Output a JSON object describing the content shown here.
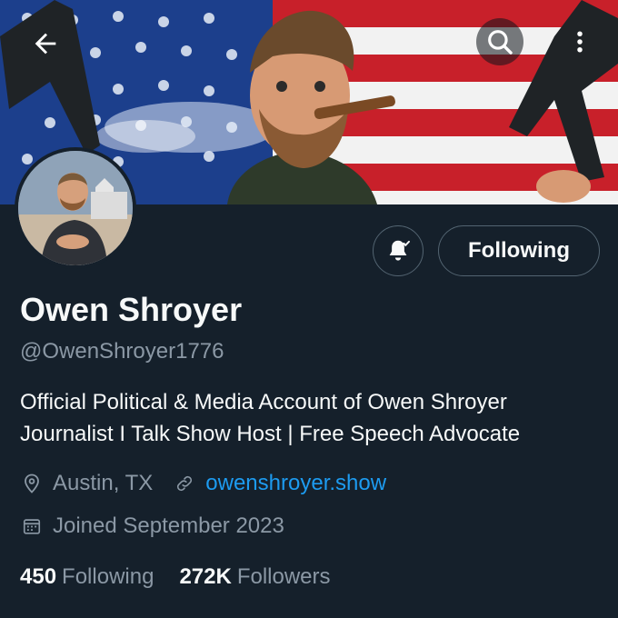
{
  "profile": {
    "display_name": "Owen Shroyer",
    "handle": "@OwenShroyer1776",
    "bio_line1": "Official Political & Media Account of Owen Shroyer",
    "bio_line2": "Journalist I Talk Show Host | Free Speech Advocate",
    "location": "Austin, TX",
    "website": "owenshroyer.show",
    "joined": "Joined September 2023"
  },
  "actions": {
    "following_label": "Following"
  },
  "stats": {
    "following_count": "450",
    "following_label": "Following",
    "followers_count": "272K",
    "followers_label": "Followers"
  },
  "icons": {
    "back": "arrow-left-icon",
    "search": "search-icon",
    "more": "more-vertical-icon",
    "notify": "bell-check-icon",
    "location": "location-pin-icon",
    "link": "link-icon",
    "calendar": "calendar-icon"
  },
  "colors": {
    "background": "#15202b",
    "text_primary": "#f7f9f9",
    "text_secondary": "#8b98a5",
    "link": "#1d9bf0",
    "border": "#536471"
  }
}
